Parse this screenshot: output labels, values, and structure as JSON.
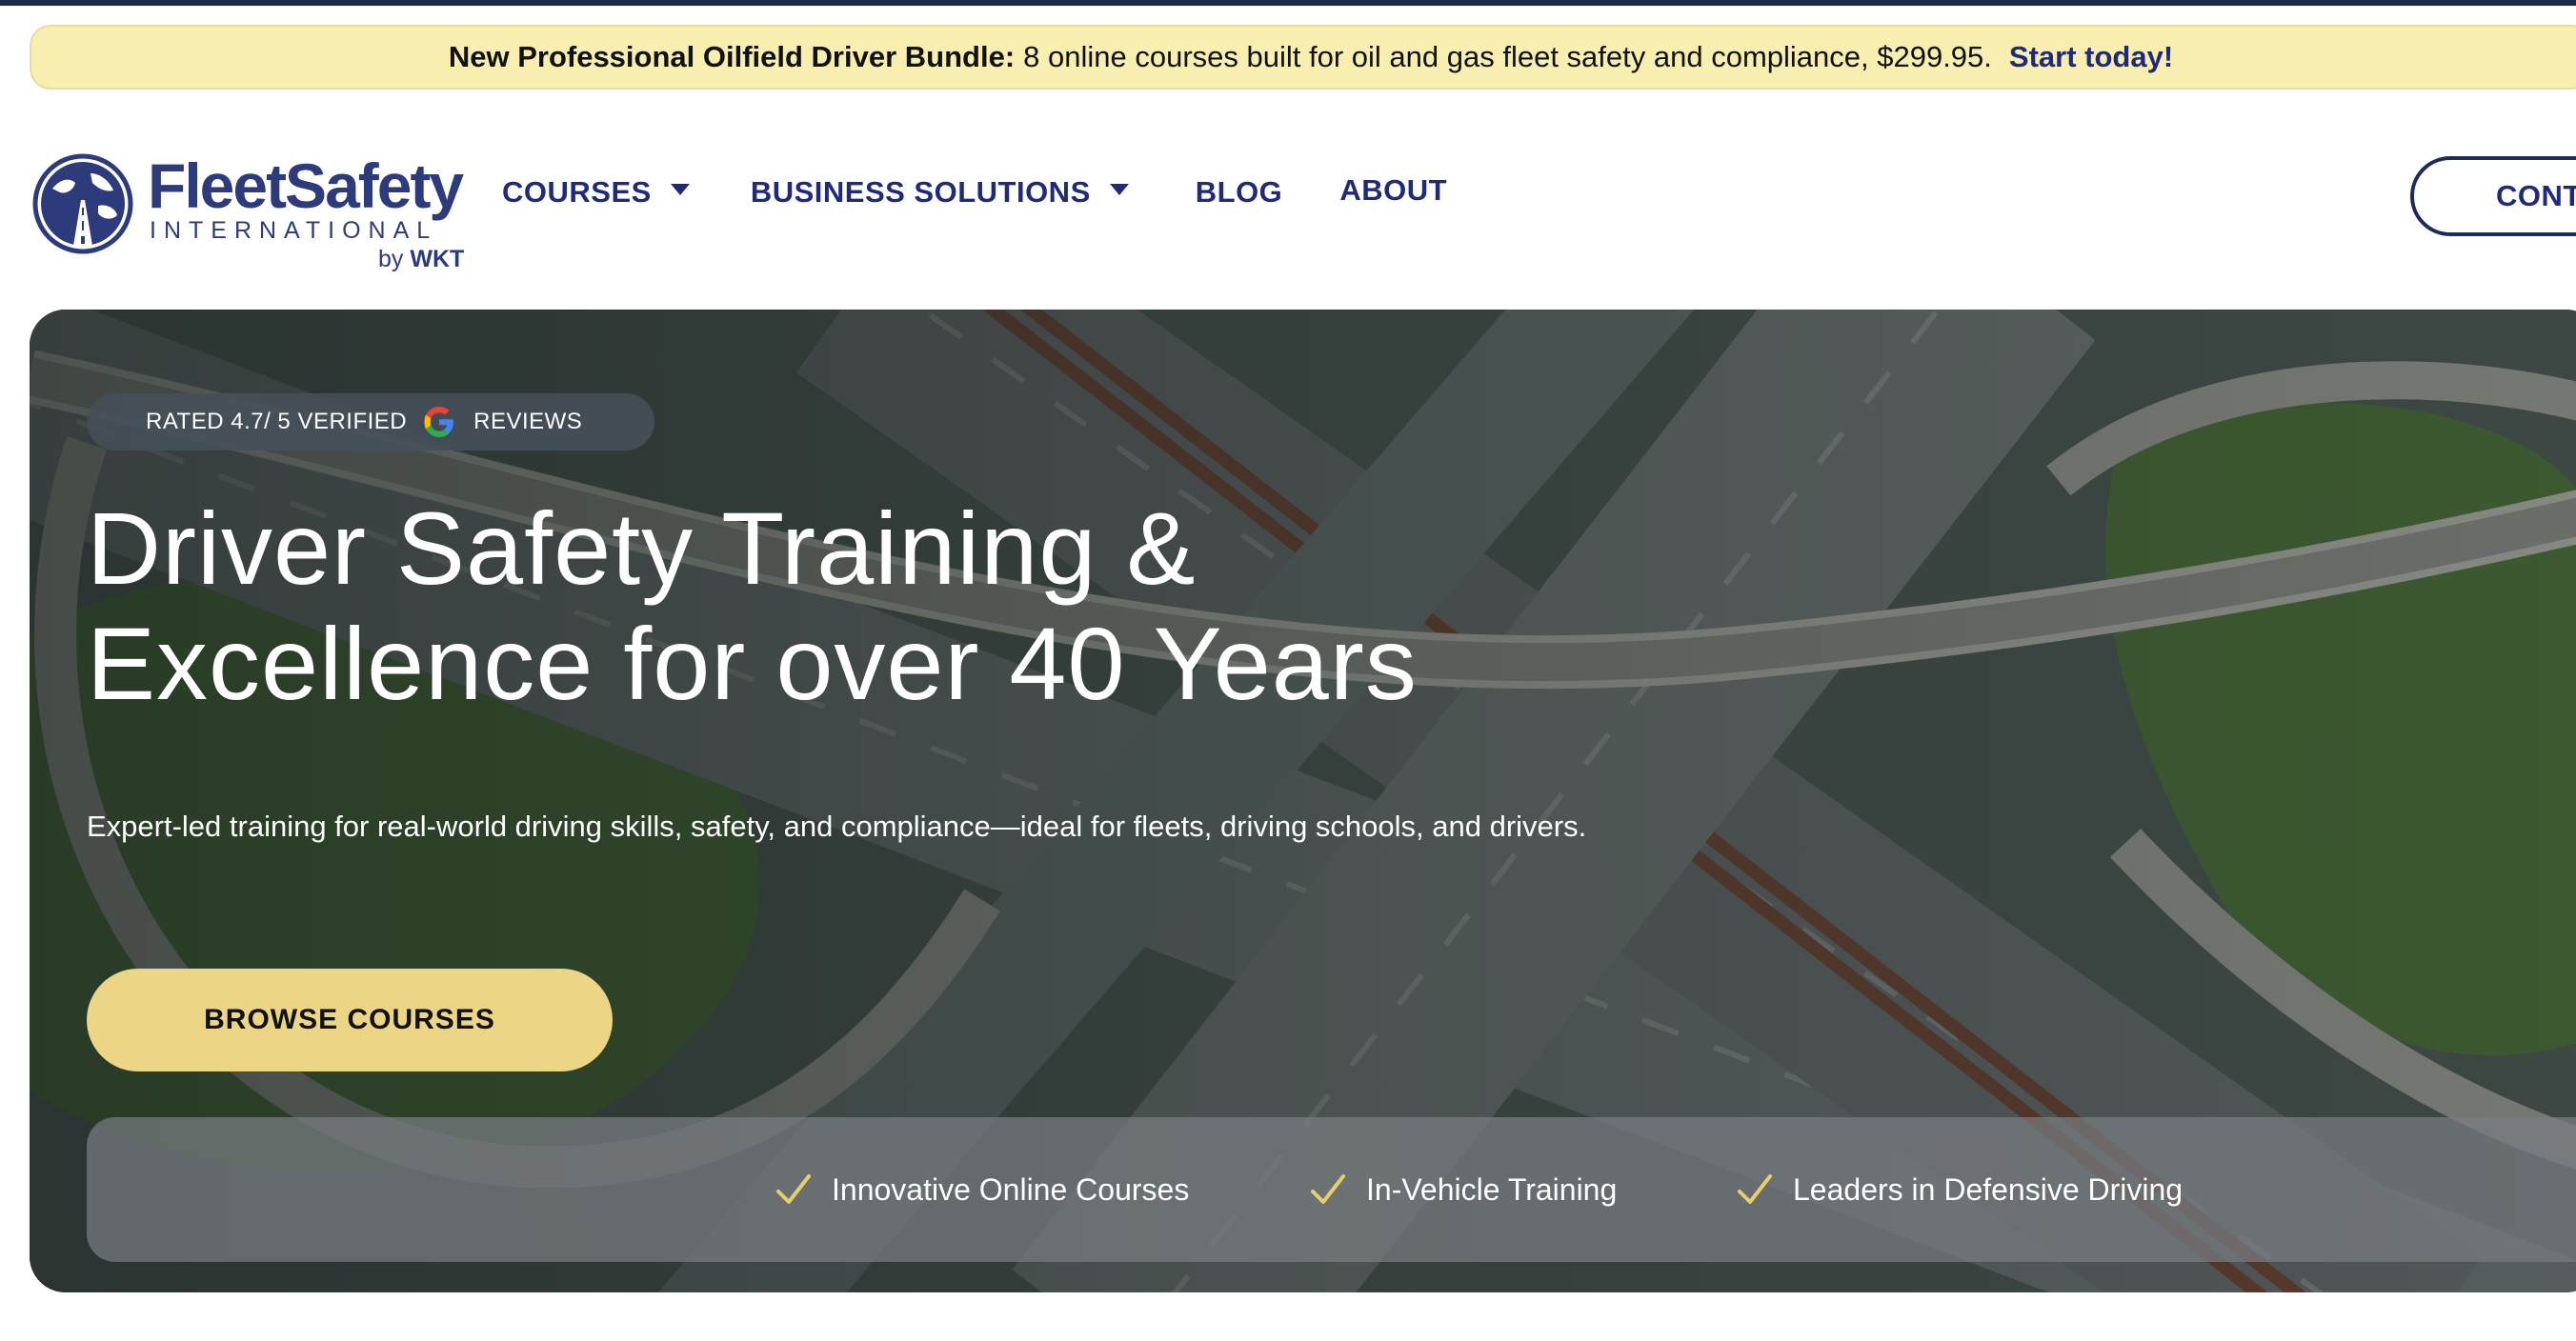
{
  "promo": {
    "lead": "New Professional Oilfield Driver Bundle:",
    "text": "8 online courses built for oil and gas fleet safety and compliance, $299.95.",
    "cta": "Start today!"
  },
  "brand": {
    "name": "FleetSafety",
    "subtitle": "INTERNATIONAL",
    "by_prefix": "by",
    "by_company": "WKT"
  },
  "nav": {
    "courses": "COURSES",
    "business": "BUSINESS SOLUTIONS",
    "blog": "BLOG",
    "about": "ABOUT",
    "contact": "CONT"
  },
  "hero": {
    "rating_left": "RATED 4.7/ 5 VERIFIED",
    "rating_right": "REVIEWS",
    "title_line1": "Driver Safety Training &",
    "title_line2": "Excellence for over 40 Years",
    "description": "Expert-led training for real-world driving skills, safety, and compliance—ideal for fleets, driving schools, and drivers.",
    "cta": "BROWSE COURSES",
    "features": [
      "Innovative Online Courses",
      "In-Vehicle Training",
      "Leaders in Defensive Driving"
    ]
  },
  "colors": {
    "navy": "#1f2a7a",
    "promo_bg": "#f7eeb0",
    "cta_gold": "#ecd685",
    "check_gold": "#e8cf6a"
  },
  "icons": {
    "logo": "globe-road-icon",
    "google": "google-g-icon",
    "feature": "check-icon",
    "dropdown": "caret-down-icon"
  }
}
